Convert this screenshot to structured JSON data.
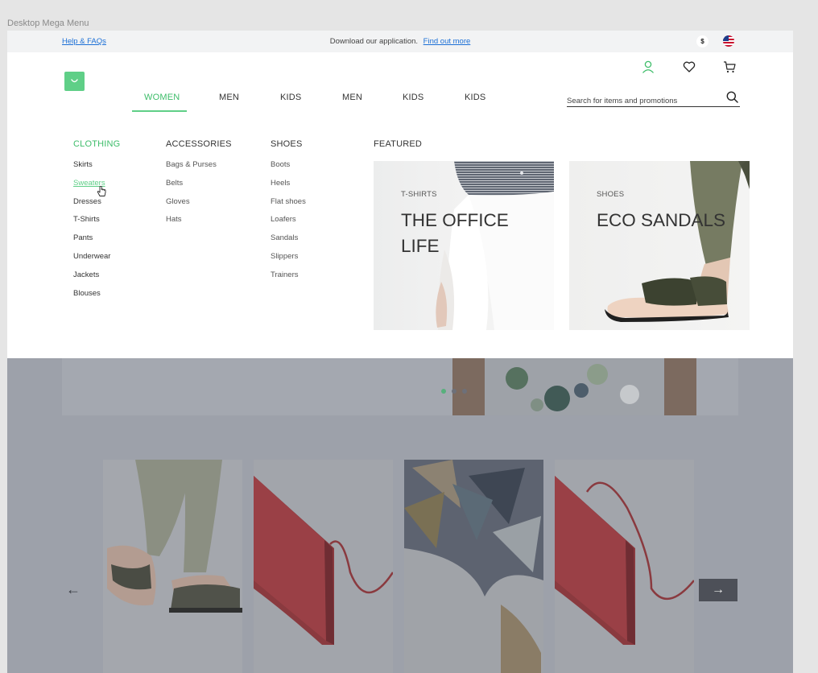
{
  "frame_label": "Desktop Mega Menu",
  "topbar": {
    "help_link": "Help & FAQs",
    "promo_text": "Download our application.",
    "promo_link": "Find out more",
    "currency": "$"
  },
  "nav": {
    "items": [
      "WOMEN",
      "MEN",
      "KIDS",
      "MEN",
      "KIDS",
      "KIDS"
    ],
    "active_index": 0
  },
  "search": {
    "placeholder": "Search for items and promotions"
  },
  "mega_menu": {
    "clothing": {
      "heading": "CLOTHING",
      "items": [
        "Skirts",
        "Sweaters",
        "Dresses",
        "T-Shirts",
        "Pants",
        "Underwear",
        "Jackets",
        "Blouses"
      ],
      "hovered": "Sweaters"
    },
    "accessories": {
      "heading": "ACCESSORIES",
      "items": [
        "Bags & Purses",
        "Belts",
        "Gloves",
        "Hats"
      ]
    },
    "shoes": {
      "heading": "SHOES",
      "items": [
        "Boots",
        "Heels",
        "Flat shoes",
        "Loafers",
        "Sandals",
        "Slippers",
        "Trainers"
      ]
    },
    "featured": {
      "heading": "FEATURED",
      "cards": [
        {
          "category": "T-SHIRTS",
          "title": "THE OFFICE LIFE"
        },
        {
          "category": "SHOES",
          "title": "ECO SANDALS"
        }
      ]
    }
  },
  "carousel": {
    "dots": 3,
    "active_dot": 0,
    "prev_arrow": "←",
    "next_arrow": "→"
  },
  "colors": {
    "accent": "#5fcf87",
    "accent_text": "#3ebd6a",
    "link": "#1b6fd6",
    "overlay": "#9da1aa"
  }
}
